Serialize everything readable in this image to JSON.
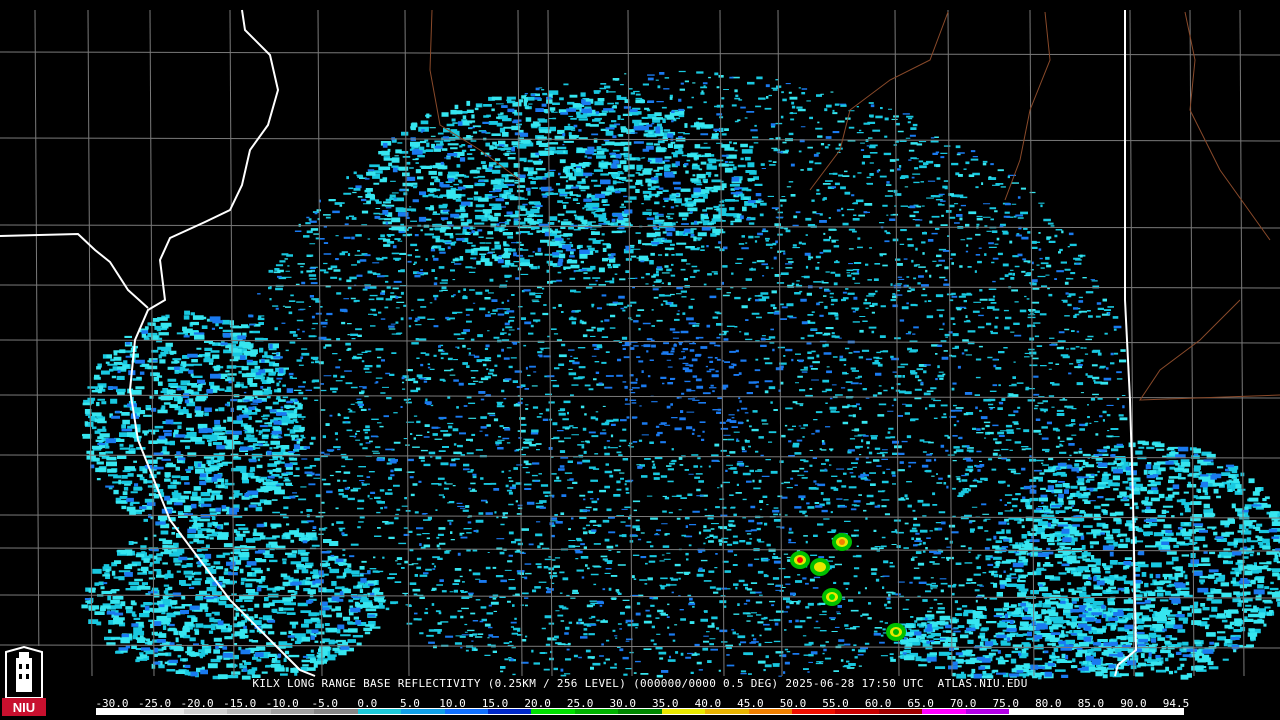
{
  "caption": "KILX LONG RANGE BASE REFLECTIVITY (0.25KM / 256 LEVEL) (000000/0000 0.5 DEG) 2025-06-28 17:50 UTC  ATLAS.NIU.EDU",
  "logo": {
    "text": "NIU",
    "icon": "university-tower-icon",
    "color": "#c8102e"
  },
  "colors": {
    "background": "#000000",
    "county_lines": "#7a7a7a",
    "state_lines": "#ffffff",
    "river_lines": "#8a4a2a",
    "echo_primary": "#19c8e0",
    "echo_light": "#36e6f0",
    "echo_dark": "#1a7af0",
    "radar_site": "#000000"
  },
  "scale": {
    "labels": [
      "-30.0",
      "-25.0",
      "-20.0",
      "-15.0",
      "-10.0",
      "-5.0",
      "0.0",
      "5.0",
      "10.0",
      "15.0",
      "20.0",
      "25.0",
      "30.0",
      "35.0",
      "40.0",
      "45.0",
      "50.0",
      "55.0",
      "60.0",
      "65.0",
      "70.0",
      "75.0",
      "80.0",
      "85.0",
      "90.0",
      "94.5"
    ],
    "colors": [
      "#ffffff",
      "#e8e8e8",
      "#cfcfcf",
      "#b8b8b8",
      "#9f9f9f",
      "#878787",
      "#1cc8d8",
      "#10a0e8",
      "#1070ff",
      "#0028c8",
      "#00e000",
      "#00b400",
      "#008800",
      "#e8e800",
      "#e8b400",
      "#f08000",
      "#f01000",
      "#c80000",
      "#a00000",
      "#ff00ff",
      "#b400e8",
      "#ffffff",
      "#ffffff",
      "#ffffff",
      "#ffffff"
    ]
  },
  "map": {
    "radar_site": "KILX",
    "storm_cells": [
      {
        "name": "storm-cell-1",
        "dbz": 55
      },
      {
        "name": "storm-cell-2",
        "dbz": 45
      },
      {
        "name": "storm-cell-3",
        "dbz": 40
      },
      {
        "name": "storm-cell-4",
        "dbz": 35
      },
      {
        "name": "storm-cell-5",
        "dbz": 30
      }
    ]
  }
}
